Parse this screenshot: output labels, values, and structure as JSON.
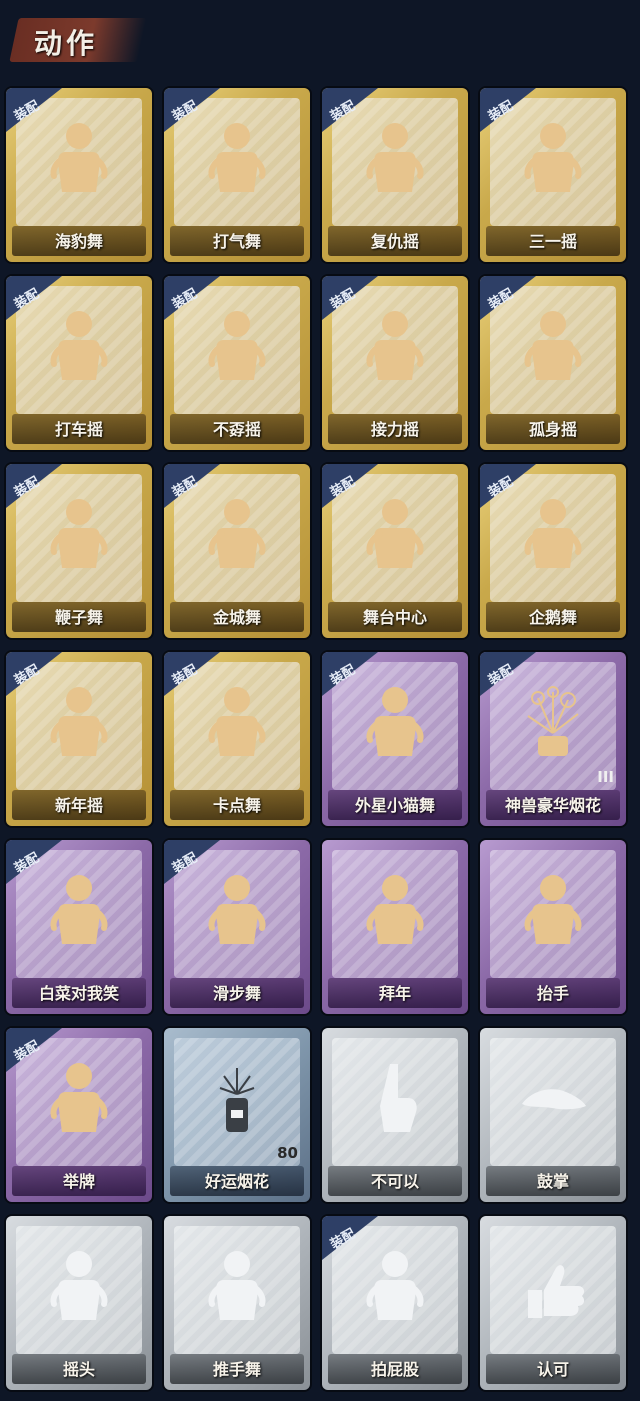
{
  "section_title": "动作",
  "equip_badge": "装配",
  "cards": [
    {
      "label": "海豹舞",
      "tier": "gold",
      "equipped": true,
      "icon": "figure-hug-icon"
    },
    {
      "label": "打气舞",
      "tier": "gold",
      "equipped": true,
      "icon": "figure-pose-icon"
    },
    {
      "label": "复仇摇",
      "tier": "gold",
      "equipped": true,
      "icon": "figure-point-up-icon"
    },
    {
      "label": "三一摇",
      "tier": "gold",
      "equipped": true,
      "icon": "figure-arms-out-icon"
    },
    {
      "label": "打车摇",
      "tier": "gold",
      "equipped": true,
      "icon": "figure-hail-icon"
    },
    {
      "label": "不孬摇",
      "tier": "gold",
      "equipped": true,
      "icon": "figure-arm-raise-icon"
    },
    {
      "label": "接力摇",
      "tier": "gold",
      "equipped": true,
      "icon": "figure-hands-hip-icon"
    },
    {
      "label": "孤身摇",
      "tier": "gold",
      "equipped": true,
      "icon": "figure-dance-icon"
    },
    {
      "label": "鞭子舞",
      "tier": "gold",
      "equipped": true,
      "icon": "figure-heart-icon"
    },
    {
      "label": "金城舞",
      "tier": "gold",
      "equipped": true,
      "icon": "figure-wave-icon"
    },
    {
      "label": "舞台中心",
      "tier": "gold",
      "equipped": true,
      "icon": "figure-sparkle-icon"
    },
    {
      "label": "企鹅舞",
      "tier": "gold",
      "equipped": true,
      "icon": "figure-penguin-icon"
    },
    {
      "label": "新年摇",
      "tier": "gold",
      "equipped": true,
      "icon": "figure-cheer-icon"
    },
    {
      "label": "卡点舞",
      "tier": "gold",
      "equipped": true,
      "icon": "figure-arm-diagonal-icon"
    },
    {
      "label": "外星小猫舞",
      "tier": "purple",
      "equipped": true,
      "icon": "figure-arms-cross-icon"
    },
    {
      "label": "神兽豪华烟花",
      "tier": "purple",
      "equipped": true,
      "icon": "fireworks-pot-icon",
      "count": "III"
    },
    {
      "label": "白菜对我笑",
      "tier": "purple",
      "equipped": true,
      "icon": "figure-flex-icon"
    },
    {
      "label": "滑步舞",
      "tier": "purple",
      "equipped": true,
      "icon": "figure-slide-icon"
    },
    {
      "label": "拜年",
      "tier": "purple",
      "equipped": false,
      "icon": "figure-bow-icon"
    },
    {
      "label": "抬手",
      "tier": "purple",
      "equipped": false,
      "icon": "figure-raise-hand-icon"
    },
    {
      "label": "举牌",
      "tier": "purple",
      "equipped": true,
      "icon": "figure-sign-icon"
    },
    {
      "label": "好运烟花",
      "tier": "blue",
      "equipped": false,
      "icon": "firework-can-icon",
      "count": "80"
    },
    {
      "label": "不可以",
      "tier": "grey",
      "equipped": false,
      "icon": "finger-wag-icon"
    },
    {
      "label": "鼓掌",
      "tier": "grey",
      "equipped": false,
      "icon": "clapping-hands-icon"
    },
    {
      "label": "摇头",
      "tier": "grey",
      "equipped": false,
      "icon": "figure-shake-head-icon"
    },
    {
      "label": "推手舞",
      "tier": "grey",
      "equipped": false,
      "icon": "figure-push-icon"
    },
    {
      "label": "拍屁股",
      "tier": "grey",
      "equipped": true,
      "icon": "figure-slap-icon"
    },
    {
      "label": "认可",
      "tier": "grey",
      "equipped": false,
      "icon": "thumbs-up-icon"
    }
  ]
}
